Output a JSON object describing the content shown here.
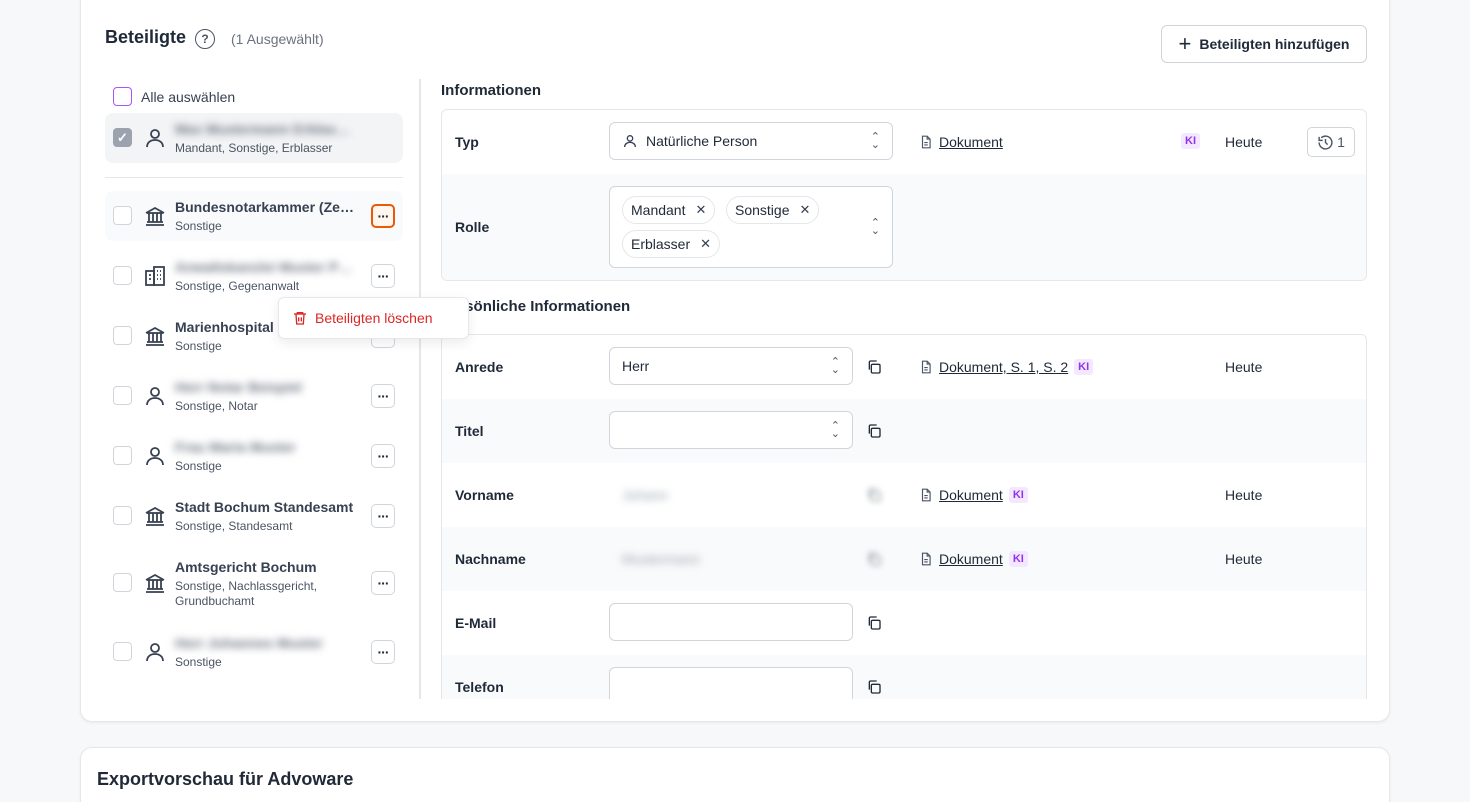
{
  "header": {
    "title": "Beteiligte",
    "help_icon": "?",
    "selected_count": "(1 Ausgewählt)",
    "add_button": "Beteiligten hinzufügen"
  },
  "list": {
    "select_all": "Alle auswählen",
    "items": [
      {
        "name": "Max Mustermann Erblasser",
        "blurred": true,
        "roles": "Mandant, Sonstige, Erblasser",
        "icon": "person-icon",
        "checked": true
      },
      {
        "name": "Bundesnotarkammer (Zentrales Testamentsregister)",
        "blurred": false,
        "roles": "Sonstige",
        "icon": "institution-icon"
      },
      {
        "name": "Anwaltskanzlei Muster Partner",
        "blurred": true,
        "roles": "Sonstige, Gegenanwalt",
        "icon": "building-icon"
      },
      {
        "name": "Marienhospital Bochum",
        "blurred": false,
        "roles": "Sonstige",
        "icon": "institution-icon"
      },
      {
        "name": "Herr Notar Beispiel",
        "blurred": true,
        "roles": "Sonstige, Notar",
        "icon": "person-icon"
      },
      {
        "name": "Frau Maria Muster",
        "blurred": true,
        "roles": "Sonstige",
        "icon": "person-icon"
      },
      {
        "name": "Stadt Bochum Standesamt",
        "blurred": false,
        "roles": "Sonstige, Standesamt",
        "icon": "institution-icon"
      },
      {
        "name": "Amtsgericht Bochum",
        "blurred": false,
        "roles": "Sonstige, Nachlassgericht, Grundbuchamt",
        "icon": "institution-icon"
      },
      {
        "name": "Herr Johannes Muster",
        "blurred": true,
        "roles": "Sonstige",
        "icon": "person-icon"
      }
    ],
    "more_label": "···"
  },
  "context_menu": {
    "delete_label": "Beteiligten löschen"
  },
  "info": {
    "title": "Informationen",
    "typ": {
      "label": "Typ",
      "value": "Natürliche Person",
      "source": "Dokument",
      "ki": "KI",
      "date": "Heute",
      "history_count": "1"
    },
    "rolle": {
      "label": "Rolle",
      "tags": [
        "Mandant",
        "Sonstige",
        "Erblasser"
      ]
    }
  },
  "personal": {
    "title": "Persönliche Informationen",
    "anrede": {
      "label": "Anrede",
      "value": "Herr",
      "source": "Dokument, S. 1, S. 2",
      "ki": "KI",
      "date": "Heute"
    },
    "titel": {
      "label": "Titel",
      "value": ""
    },
    "vorname": {
      "label": "Vorname",
      "value": "Johann",
      "source": "Dokument",
      "ki": "KI",
      "date": "Heute"
    },
    "nachname": {
      "label": "Nachname",
      "value": "Mustermann",
      "source": "Dokument",
      "ki": "KI",
      "date": "Heute"
    },
    "email": {
      "label": "E-Mail",
      "value": ""
    },
    "telefon": {
      "label": "Telefon",
      "value": ""
    }
  },
  "export": {
    "title": "Exportvorschau für Advoware"
  }
}
